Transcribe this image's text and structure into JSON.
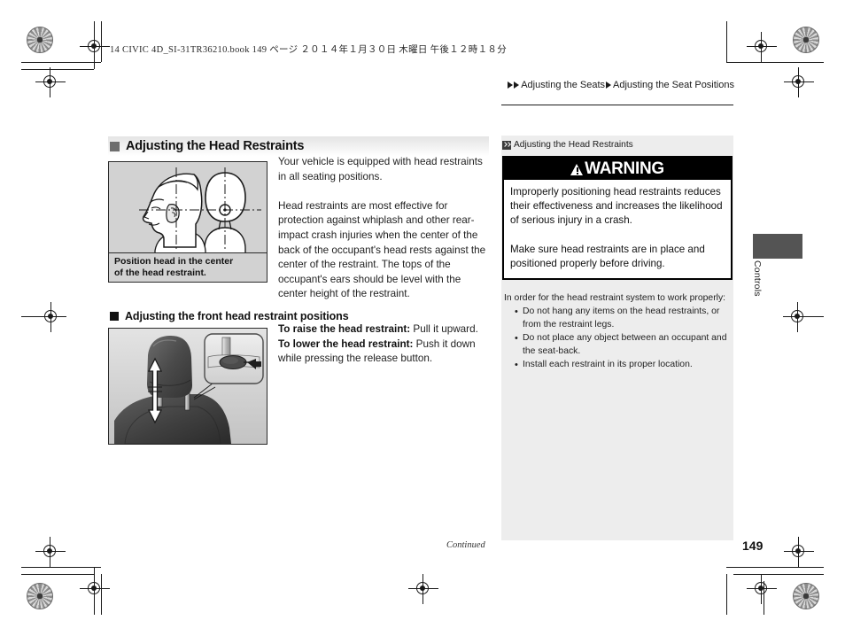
{
  "print_header": "14 CIVIC 4D_SI-31TR36210.book   149 ページ   ２０１４年１月３０日   木曜日   午後１２時１８分",
  "breadcrumb": {
    "seg1": "Adjusting the Seats",
    "seg2": "Adjusting the Seat Positions"
  },
  "section": {
    "title": "Adjusting the Head Restraints",
    "sub_title": "Adjusting the front head restraint positions"
  },
  "figure1": {
    "caption_line1": "Position head in the center",
    "caption_line2": "of the head restraint."
  },
  "body": {
    "para1": "Your vehicle is equipped with head restraints in all seating positions.",
    "para2": "Head restraints are most effective for protection against whiplash and other rear-impact crash injuries when the center of the back of the occupant's head rests against the center of the restraint. The tops of the occupant's ears should be level with the center height of the restraint."
  },
  "instructions": {
    "raise_label": "To raise the head restraint:",
    "raise_text": " Pull it upward.",
    "lower_label": "To lower the head restraint:",
    "lower_text": " Push it down while pressing the release button."
  },
  "reference": {
    "title": "Adjusting the Head Restraints",
    "warning_label": "WARNING",
    "warning_para1": "Improperly positioning head restraints reduces their effectiveness and increases the likelihood of serious injury in a crash.",
    "warning_para2": "Make sure head restraints are in place and positioned properly before driving.",
    "note_lead": "In order for the head restraint system to work properly:",
    "note_items": [
      "Do not hang any items on the head restraints, or from the restraint legs.",
      "Do not place any object between an occupant and the seat-back.",
      "Install each restraint in its proper location."
    ]
  },
  "side_tab": {
    "label": "Controls"
  },
  "footer": {
    "continued": "Continued",
    "page_number": "149"
  }
}
